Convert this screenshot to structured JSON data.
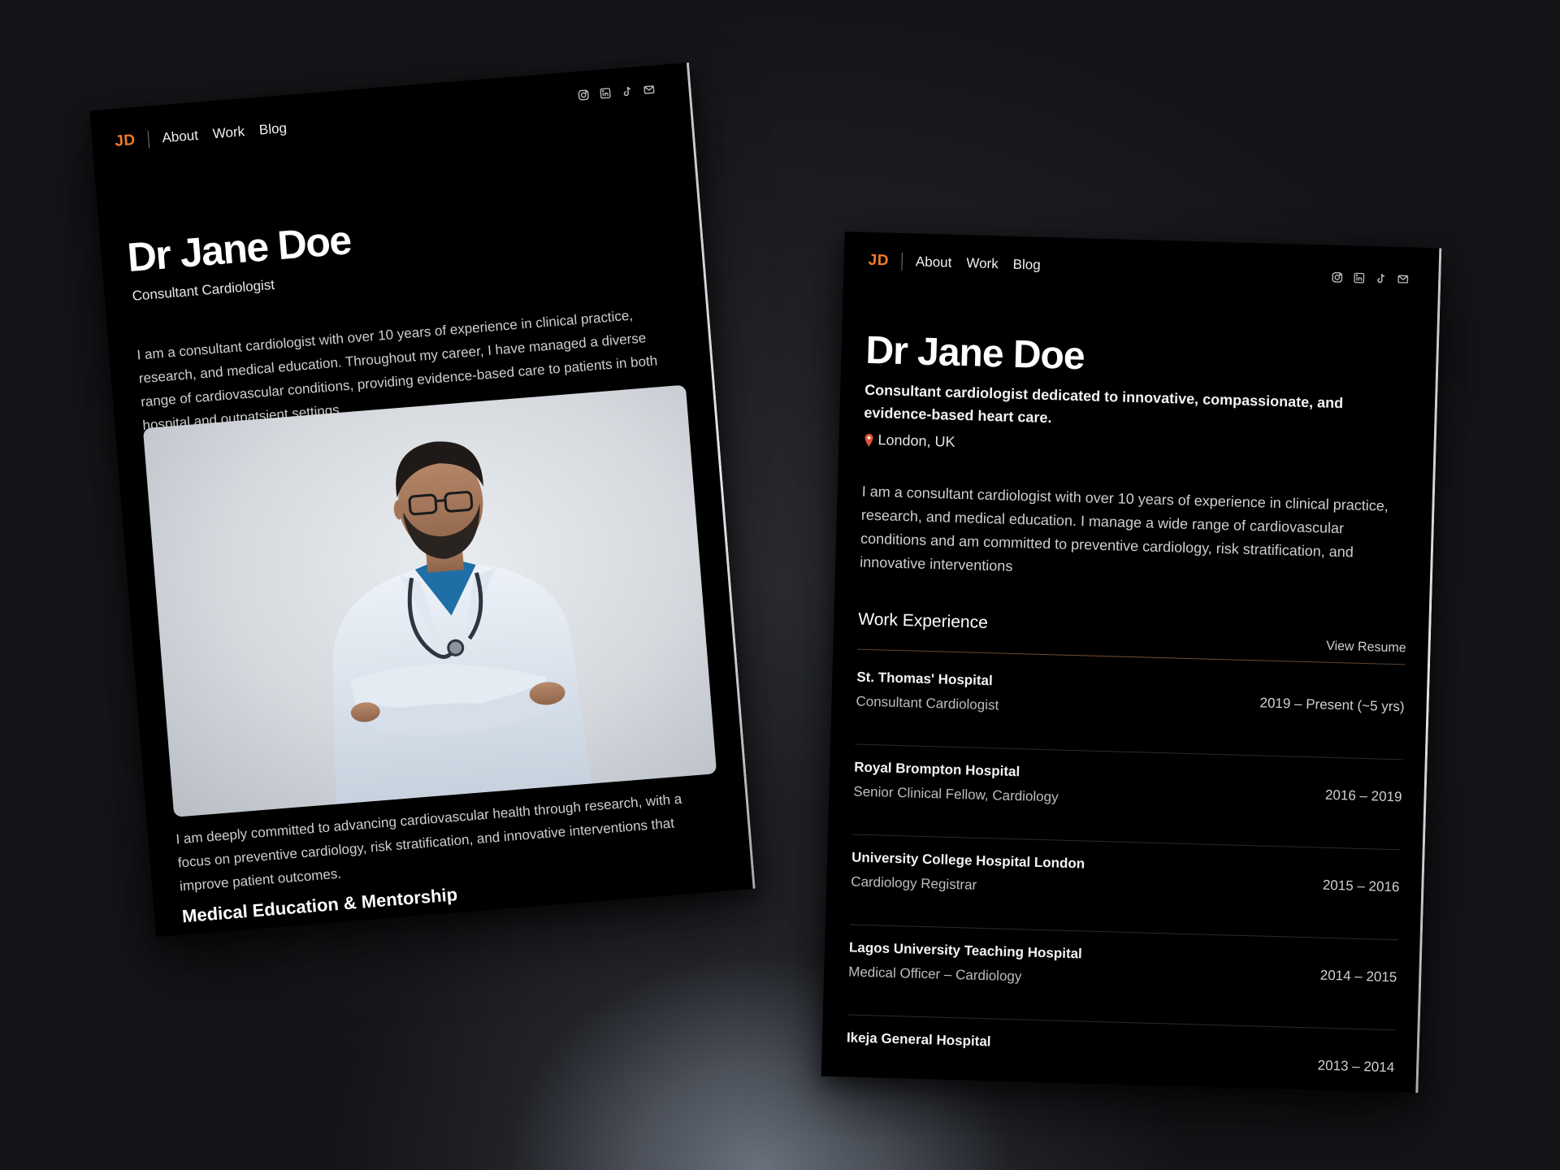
{
  "colors": {
    "accent": "#f07a28",
    "page_background": "#1a1b1f",
    "card_background": "#000000"
  },
  "left_page": {
    "logo": "JD",
    "nav": [
      "About",
      "Work",
      "Blog"
    ],
    "socials": [
      "instagram-icon",
      "linkedin-icon",
      "tiktok-icon",
      "mail-icon"
    ],
    "title": "Dr Jane Doe",
    "subtitle": "Consultant Cardiologist",
    "intro": "I am a consultant cardiologist with over 10 years of experience in clinical practice, research, and medical education. Throughout my career, I have managed a diverse range of cardiovascular conditions, providing evidence-based care to patients in both hospital and outpatsient settings.",
    "commitment": "I am deeply committed to advancing cardiovascular health through research, with a focus on preventive cardiology, risk stratification, and innovative interventions that improve patient outcomes.",
    "section_heading": "Medical Education & Mentorship"
  },
  "right_page": {
    "logo": "JD",
    "nav": [
      "About",
      "Work",
      "Blog"
    ],
    "socials": [
      "instagram-icon",
      "linkedin-icon",
      "tiktok-icon",
      "mail-icon"
    ],
    "title": "Dr Jane Doe",
    "tagline": "Consultant cardiologist dedicated to innovative, compassionate, and evidence-based heart care.",
    "location": "London, UK",
    "intro": "I am a consultant cardiologist with over 10 years of experience in clinical practice, research, and medical education. I manage a wide range of cardiovascular conditions and am committed to preventive cardiology, risk stratification, and innovative interventions",
    "work_heading": "Work Experience",
    "resume_link": "View Resume",
    "jobs": [
      {
        "name": "St. Thomas' Hospital",
        "role": "Consultant Cardiologist",
        "dates": "2019 – Present (~5 yrs)"
      },
      {
        "name": "Royal Brompton Hospital",
        "role": "Senior Clinical Fellow, Cardiology",
        "dates": "2016 – 2019"
      },
      {
        "name": "University College Hospital London",
        "role": "Cardiology Registrar",
        "dates": "2015 – 2016"
      },
      {
        "name": "Lagos University Teaching Hospital",
        "role": "Medical Officer – Cardiology",
        "dates": "2014 – 2015"
      },
      {
        "name": "Ikeja General Hospital",
        "role": "",
        "dates": "2013 – 2014"
      }
    ]
  }
}
